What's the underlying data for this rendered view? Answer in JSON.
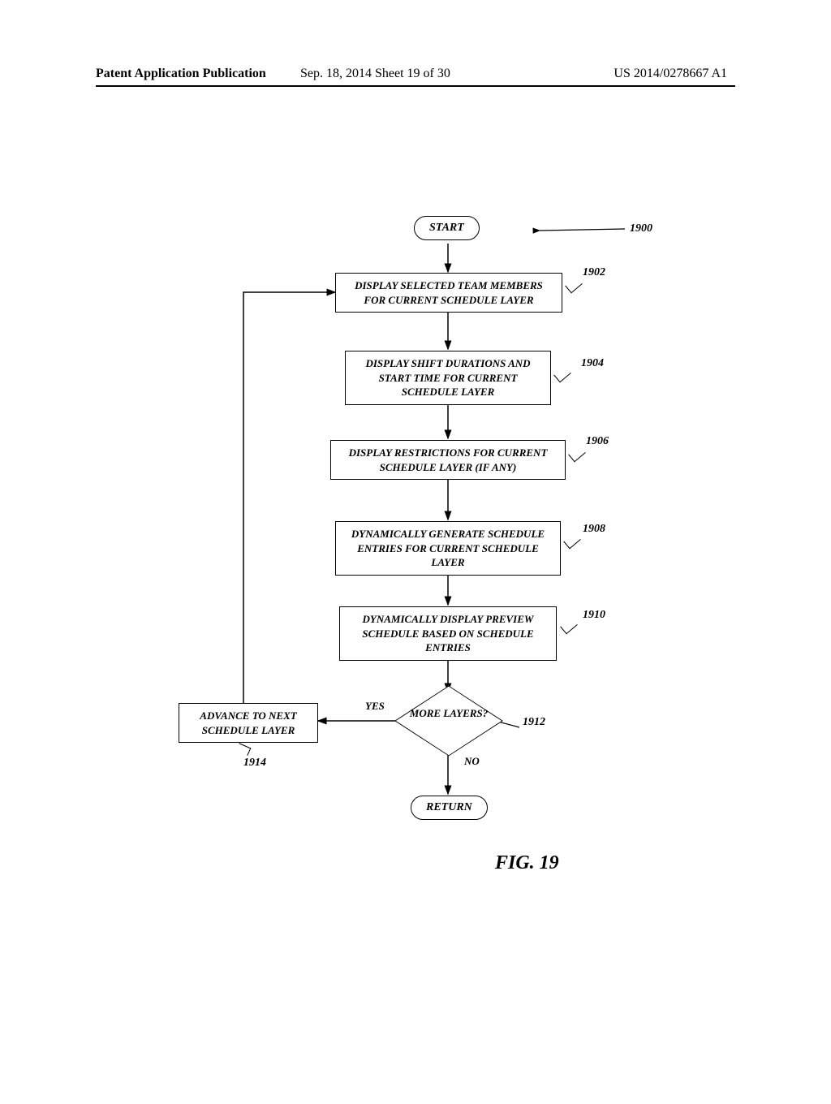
{
  "header": {
    "left": "Patent Application Publication",
    "center": "Sep. 18, 2014  Sheet 19 of 30",
    "right": "US 2014/0278667 A1"
  },
  "chart_data": {
    "type": "flowchart",
    "title": "FIG. 19",
    "nodes": [
      {
        "id": "start",
        "type": "terminal",
        "label": "START"
      },
      {
        "id": "1902",
        "type": "process",
        "label": "DISPLAY SELECTED TEAM MEMBERS FOR CURRENT SCHEDULE LAYER",
        "ref": "1902"
      },
      {
        "id": "1904",
        "type": "process",
        "label": "DISPLAY SHIFT DURATIONS AND START TIME FOR CURRENT SCHEDULE LAYER",
        "ref": "1904"
      },
      {
        "id": "1906",
        "type": "process",
        "label": "DISPLAY RESTRICTIONS FOR CURRENT SCHEDULE LAYER (IF ANY)",
        "ref": "1906"
      },
      {
        "id": "1908",
        "type": "process",
        "label": "DYNAMICALLY GENERATE SCHEDULE ENTRIES FOR CURRENT SCHEDULE LAYER",
        "ref": "1908"
      },
      {
        "id": "1910",
        "type": "process",
        "label": "DYNAMICALLY DISPLAY PREVIEW SCHEDULE BASED ON SCHEDULE ENTRIES",
        "ref": "1910"
      },
      {
        "id": "1912",
        "type": "decision",
        "label": "MORE LAYERS?",
        "ref": "1912"
      },
      {
        "id": "1914",
        "type": "process",
        "label": "ADVANCE TO NEXT SCHEDULE LAYER",
        "ref": "1914"
      },
      {
        "id": "return",
        "type": "terminal",
        "label": "RETURN"
      }
    ],
    "edges": [
      {
        "from": "start",
        "to": "1902"
      },
      {
        "from": "1902",
        "to": "1904"
      },
      {
        "from": "1904",
        "to": "1906"
      },
      {
        "from": "1906",
        "to": "1908"
      },
      {
        "from": "1908",
        "to": "1910"
      },
      {
        "from": "1910",
        "to": "1912"
      },
      {
        "from": "1912",
        "to": "1914",
        "label": "YES"
      },
      {
        "from": "1912",
        "to": "return",
        "label": "NO"
      },
      {
        "from": "1914",
        "to": "1902"
      }
    ],
    "overall_ref": "1900"
  }
}
